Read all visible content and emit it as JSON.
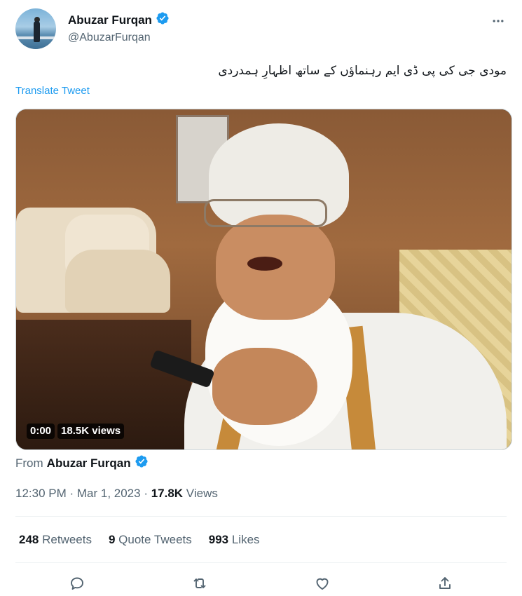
{
  "author": {
    "display_name": "Abuzar Furqan",
    "handle": "@AbuzarFurqan",
    "verified_icon": "verified-badge-icon"
  },
  "tweet": {
    "text": "مودی جی کی پی ڈی ایم رہنماؤں کے ساتھ اظہارِ ہمدردی",
    "translate_label": "Translate Tweet"
  },
  "video": {
    "time": "0:00",
    "views": "18.5K views"
  },
  "from": {
    "prefix": "From",
    "name": "Abuzar Furqan"
  },
  "meta": {
    "time_date": "12:30 PM · Mar 1, 2023 · ",
    "views_count": "17.8K",
    "views_label": " Views"
  },
  "stats": {
    "retweets_count": "248",
    "retweets_label": " Retweets",
    "quotes_count": "9",
    "quotes_label": " Quote Tweets",
    "likes_count": "993",
    "likes_label": " Likes"
  },
  "colors": {
    "accent": "#1d9bf0",
    "secondary_text": "#536471",
    "primary_text": "#0f1419"
  }
}
